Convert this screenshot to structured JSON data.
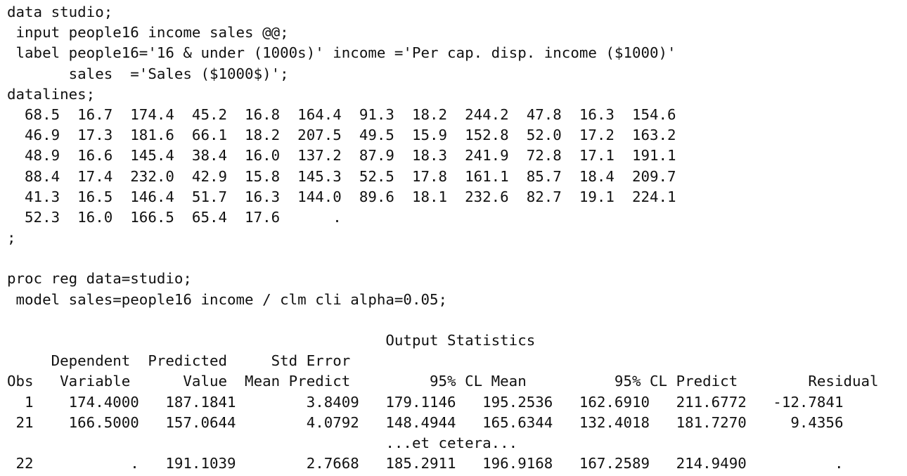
{
  "code": {
    "data_step": [
      "data studio;",
      " input people16 income sales @@;",
      " label people16='16 & under (1000s)' income ='Per cap. disp. income ($1000)'",
      "       sales  ='Sales ($1000$)';",
      "datalines;",
      "  68.5  16.7  174.4  45.2  16.8  164.4  91.3  18.2  244.2  47.8  16.3  154.6",
      "  46.9  17.3  181.6  66.1  18.2  207.5  49.5  15.9  152.8  52.0  17.2  163.2",
      "  48.9  16.6  145.4  38.4  16.0  137.2  87.9  18.3  241.9  72.8  17.1  191.1",
      "  88.4  17.4  232.0  42.9  15.8  145.3  52.5  17.8  161.1  85.7  18.4  209.7",
      "  41.3  16.5  146.4  51.7  16.3  144.0  89.6  18.1  232.6  82.7  19.1  224.1",
      "  52.3  16.0  166.5  65.4  17.6      .",
      ";",
      ""
    ],
    "proc_step": [
      "proc reg data=studio;",
      " model sales=people16 income / clm cli alpha=0.05;",
      ""
    ]
  },
  "output": {
    "title": "                                           Output Statistics",
    "header1": "     Dependent  Predicted     Std Error",
    "header2": "Obs   Variable      Value  Mean Predict         95% CL Mean          95% CL Predict        Residual",
    "rows": [
      "  1    174.4000   187.1841        3.8409   179.1146   195.2536   162.6910   211.6772   -12.7841",
      " 21    166.5000   157.0644        4.0792   148.4944   165.6344   132.4018   181.7270     9.4356"
    ],
    "ellipsis": "                                           ...et cetera...",
    "last_row": " 22           .   191.1039        2.7668   185.2911   196.9168   167.2589   214.9490          ."
  }
}
